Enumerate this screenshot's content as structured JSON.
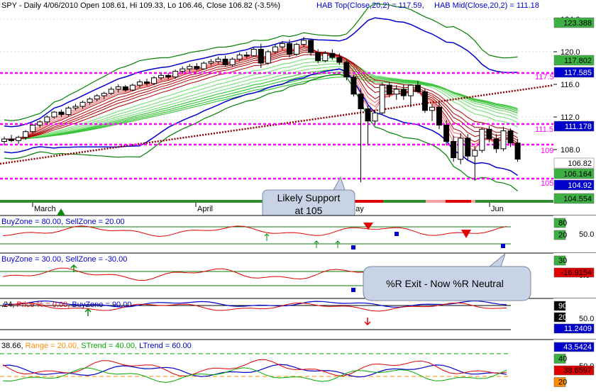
{
  "header": {
    "symbol": "SPY",
    "summary": "SPY - Daily 4/06/2010 Open 108.61, Hi 109.33, Lo 106.46, Close 106.82 (-3.5%)",
    "hab_top": "HAB Top(Close,20,2) = 117.59,",
    "hab_mid": "HAB Mid(Close,20,2) = 111.18"
  },
  "colors": {
    "up": "#ffffff",
    "down": "#000000",
    "support": "#ff00ff",
    "trend": "#8b0000",
    "blue": "#0000cc",
    "green_band": "#008000",
    "red_ribbon": "#cc0000",
    "green_ribbon": "#00cc00"
  },
  "months": [
    "March",
    "April",
    "May",
    "Jun"
  ],
  "callouts": {
    "support_line1": "Likely Support",
    "support_line2": "at 105",
    "exit": "%R Exit - Now %R Neutral"
  },
  "level_labels": {
    "l117": "117.5",
    "l111": "111.5",
    "l109": "109",
    "l105": "105"
  },
  "price_axis": {
    "ticks": [
      "124.0",
      "120.0",
      "116.0",
      "112.0",
      "108.0"
    ],
    "boxes": [
      {
        "v": "123.388",
        "bg": "#3cb043",
        "fg": "#000"
      },
      {
        "v": "117.802",
        "bg": "#3cb043",
        "fg": "#000"
      },
      {
        "v": "117.585",
        "bg": "#0000cc",
        "fg": "#fff"
      },
      {
        "v": "111.178",
        "bg": "#0000cc",
        "fg": "#fff"
      },
      {
        "v": "106.82",
        "bg": "#ffffff",
        "fg": "#000"
      },
      {
        "v": "106.164",
        "bg": "#3cb043",
        "fg": "#000"
      },
      {
        "v": "104.92",
        "bg": "#0000cc",
        "fg": "#fff"
      },
      {
        "v": "104.554",
        "bg": "#3cb043",
        "fg": "#000"
      }
    ]
  },
  "panels": [
    {
      "id": "p1",
      "title": "BuyZone = 80.00, SellZone = 20.00",
      "boxes": [
        {
          "v": "80",
          "bg": "#3cb043",
          "fg": "#000"
        },
        {
          "v": "20",
          "bg": "#3cb043",
          "fg": "#000"
        }
      ],
      "tick": "50.0"
    },
    {
      "id": "p2",
      "title_a": "BuyZone = 30.00, SellZone = -30.00",
      "boxes": [
        {
          "v": "30",
          "bg": "#3cb043",
          "fg": "#000"
        },
        {
          "v": "-16.9154",
          "bg": "#e00000",
          "fg": "#000"
        }
      ],
      "tick": "0.0"
    },
    {
      "id": "p3",
      "pre": ".24,",
      "mid": "Price % = 0.00,",
      "post": "BuyZone = 90.00",
      "boxes": [
        {
          "v": "90",
          "bg": "#000",
          "fg": "#fff"
        },
        {
          "v": "20",
          "bg": "#000",
          "fg": "#fff"
        },
        {
          "v": "11.2409",
          "bg": "#0000cc",
          "fg": "#fff"
        }
      ],
      "tick": "50.0"
    },
    {
      "id": "p4",
      "pre": "38.66,",
      "range": "Range = 20.00,",
      "st": "STrend = 40.00,",
      "lt": "LTrend = 60.00",
      "boxes": [
        {
          "v": "43.5424",
          "bg": "#0000cc",
          "fg": "#fff"
        },
        {
          "v": "40",
          "bg": "#3cb043",
          "fg": "#000"
        },
        {
          "v": "38.6597",
          "bg": "#e00000",
          "fg": "#000"
        },
        {
          "v": "20",
          "bg": "#ff8c00",
          "fg": "#000"
        }
      ],
      "tick": "50.0"
    }
  ],
  "chart_data": {
    "type": "candlestick",
    "x_start": "2010-02-22",
    "x_end": "2010-06-08",
    "ylim": [
      103.5,
      125
    ],
    "support_levels": [
      117.5,
      111.5,
      109,
      105
    ],
    "candles": [
      [
        109.0,
        109.6,
        108.5,
        109.3
      ],
      [
        109.3,
        109.8,
        108.9,
        109.1
      ],
      [
        109.1,
        109.7,
        108.7,
        109.5
      ],
      [
        109.5,
        110.4,
        109.2,
        110.2
      ],
      [
        110.2,
        111.1,
        109.9,
        111.0
      ],
      [
        111.0,
        111.6,
        110.7,
        111.4
      ],
      [
        111.4,
        112.2,
        111.1,
        112.0
      ],
      [
        112.0,
        112.7,
        111.8,
        112.6
      ],
      [
        112.6,
        112.9,
        112.0,
        112.3
      ],
      [
        112.3,
        113.3,
        112.1,
        113.1
      ],
      [
        113.1,
        113.6,
        112.8,
        113.3
      ],
      [
        113.3,
        114.0,
        113.0,
        113.8
      ],
      [
        113.8,
        114.4,
        113.5,
        114.2
      ],
      [
        114.2,
        114.8,
        113.9,
        114.6
      ],
      [
        114.6,
        115.1,
        114.2,
        114.9
      ],
      [
        114.9,
        115.7,
        114.7,
        115.4
      ],
      [
        115.4,
        116.0,
        115.0,
        115.7
      ],
      [
        115.7,
        115.9,
        115.1,
        115.3
      ],
      [
        115.3,
        116.1,
        115.2,
        115.9
      ],
      [
        115.9,
        116.6,
        115.6,
        116.3
      ],
      [
        116.3,
        116.7,
        115.8,
        116.1
      ],
      [
        116.1,
        117.0,
        115.9,
        116.8
      ],
      [
        116.8,
        117.4,
        116.5,
        117.1
      ],
      [
        117.1,
        117.4,
        116.6,
        116.9
      ],
      [
        116.9,
        117.8,
        116.7,
        117.6
      ],
      [
        117.6,
        118.2,
        117.3,
        117.9
      ],
      [
        117.9,
        118.5,
        117.5,
        118.2
      ],
      [
        118.2,
        118.6,
        117.7,
        117.9
      ],
      [
        117.9,
        118.8,
        117.8,
        118.6
      ],
      [
        118.6,
        119.1,
        118.3,
        118.8
      ],
      [
        118.8,
        119.4,
        118.5,
        119.1
      ],
      [
        119.1,
        119.5,
        118.2,
        118.4
      ],
      [
        118.4,
        119.3,
        118.2,
        119.1
      ],
      [
        119.1,
        119.9,
        118.8,
        119.6
      ],
      [
        119.6,
        120.0,
        119.2,
        119.5
      ],
      [
        119.5,
        120.5,
        119.4,
        120.3
      ],
      [
        120.3,
        121.0,
        118.0,
        118.6
      ],
      [
        118.6,
        120.2,
        118.4,
        120.0
      ],
      [
        120.0,
        120.9,
        119.7,
        120.6
      ],
      [
        120.6,
        121.3,
        120.2,
        121.0
      ],
      [
        121.0,
        121.5,
        119.3,
        119.7
      ],
      [
        119.7,
        121.1,
        119.5,
        120.9
      ],
      [
        120.9,
        121.8,
        120.6,
        121.4
      ],
      [
        121.4,
        121.6,
        119.5,
        119.9
      ],
      [
        119.9,
        120.3,
        118.6,
        118.9
      ],
      [
        118.9,
        120.1,
        118.7,
        119.8
      ],
      [
        119.8,
        120.3,
        119.0,
        119.3
      ],
      [
        119.3,
        119.8,
        118.4,
        118.7
      ],
      [
        118.7,
        119.0,
        116.5,
        116.9
      ],
      [
        116.9,
        117.2,
        114.5,
        114.8
      ],
      [
        114.8,
        115.5,
        104.0,
        113.0
      ],
      [
        113.0,
        113.4,
        108.5,
        111.5
      ],
      [
        111.5,
        112.8,
        111.0,
        112.5
      ],
      [
        112.5,
        116.2,
        112.3,
        115.9
      ],
      [
        115.9,
        116.3,
        114.4,
        114.8
      ],
      [
        114.8,
        115.9,
        114.1,
        115.4
      ],
      [
        115.4,
        116.0,
        114.1,
        114.6
      ],
      [
        114.6,
        116.0,
        113.2,
        115.9
      ],
      [
        115.9,
        116.4,
        114.9,
        115.1
      ],
      [
        115.1,
        115.5,
        112.5,
        112.8
      ],
      [
        112.8,
        113.6,
        111.5,
        113.2
      ],
      [
        113.2,
        113.8,
        110.5,
        111.0
      ],
      [
        111.0,
        111.6,
        108.5,
        109.0
      ],
      [
        109.0,
        109.7,
        106.5,
        107.0
      ],
      [
        106.8,
        110.0,
        106.2,
        109.4
      ],
      [
        109.4,
        109.9,
        106.7,
        107.2
      ],
      [
        107.2,
        108.4,
        104.2,
        107.9
      ],
      [
        107.9,
        110.7,
        107.6,
        110.5
      ],
      [
        110.5,
        110.9,
        108.9,
        109.3
      ],
      [
        109.3,
        109.9,
        107.6,
        108.1
      ],
      [
        108.1,
        110.8,
        107.8,
        110.3
      ],
      [
        110.3,
        110.6,
        108.3,
        108.8
      ],
      [
        108.8,
        109.3,
        106.5,
        106.82
      ]
    ]
  }
}
